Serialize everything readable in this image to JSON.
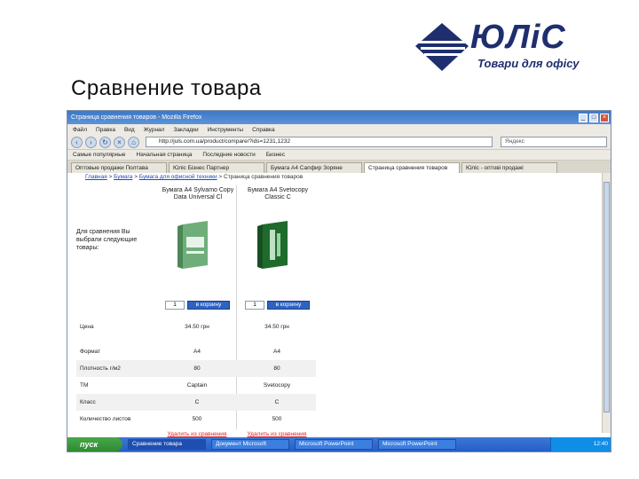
{
  "logo": {
    "brand": "ЮЛіС",
    "tagline": "Товари для офісу"
  },
  "slide_title": "Сравнение товара",
  "browser": {
    "window_title": "Страница сравнения товаров - Mozilla Firefox",
    "menu": [
      "Файл",
      "Правка",
      "Вид",
      "Журнал",
      "Закладки",
      "Инструменты",
      "Справка"
    ],
    "url": "http://juls.com.ua/product/compare/?ids=1231,1232",
    "search_placeholder": "Яндекс",
    "bookmarks": [
      "Самые популярные",
      "Начальная страница",
      "Последние новости",
      "Бизнес"
    ],
    "tabs": [
      {
        "label": "Оптовые продажи Полтава",
        "active": false
      },
      {
        "label": "Юліс Бізнес Партнер",
        "active": false
      },
      {
        "label": "Бумага А4 Сапфир Зоряне",
        "active": false
      },
      {
        "label": "Страница сравнения товаров",
        "active": true
      },
      {
        "label": "Юліс - оптові продажі",
        "active": false
      }
    ]
  },
  "page": {
    "breadcrumb": {
      "home": "Главная",
      "catalog": "Бумага",
      "section": "Бумага для офисной техники",
      "current": "Страница сравнения товаров"
    },
    "intro": "Для сравнения Вы выбрали следующие товары:",
    "products": [
      {
        "name": "Бумага А4 Sylvamo Copy Data Universal Cl",
        "qty": "1",
        "cart_label": "в корзину",
        "price": "34.50 грн",
        "format": "A4",
        "density": "80",
        "brand": "Captain",
        "class": "C",
        "sheets": "500",
        "remove_label": "Удалить из сравнения",
        "box_color": "#6fae7a"
      },
      {
        "name": "Бумага А4 Svetocopy Classic C",
        "qty": "1",
        "cart_label": "в корзину",
        "price": "34.50 грн",
        "format": "A4",
        "density": "80",
        "brand": "Svetocopy",
        "class": "C",
        "sheets": "500",
        "remove_label": "Удалить из сравнения",
        "box_color": "#1f6b2c"
      }
    ],
    "row_labels": {
      "price": "Цена",
      "format": "Формат",
      "density": "Плотность г/м2",
      "brand": "ТМ",
      "class": "Класс",
      "sheets": "Количество листов"
    }
  },
  "taskbar": {
    "start": "пуск",
    "tasks": [
      {
        "label": "Сравнение товара",
        "active": true
      },
      {
        "label": "Документ Microsoft",
        "active": false
      },
      {
        "label": "Microsoft PowerPoint",
        "active": false
      },
      {
        "label": "Microsoft PowerPoint",
        "active": false
      }
    ],
    "clock": "12:40"
  }
}
